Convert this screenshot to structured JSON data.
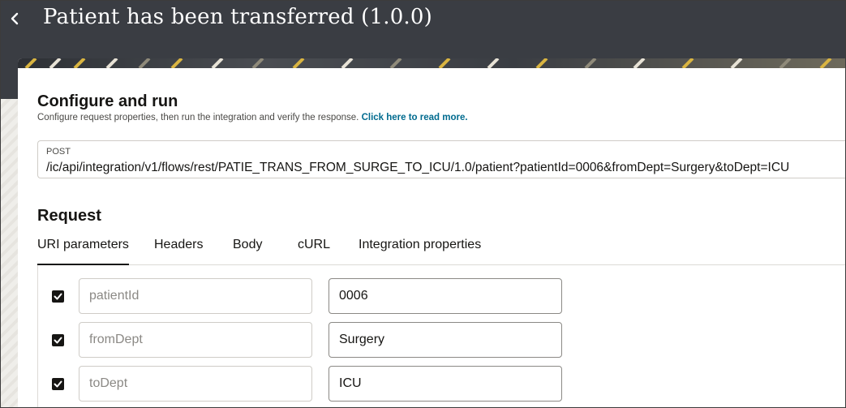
{
  "header": {
    "title": "Patient has been transferred (1.0.0)",
    "back_icon": "chevron-left-icon"
  },
  "configure": {
    "title": "Configure and run",
    "description": "Configure request properties, then run the integration and verify the response.",
    "link_text": "Click here to read more."
  },
  "endpoint": {
    "method": "POST",
    "url": "/ic/api/integration/v1/flows/rest/PATIE_TRANS_FROM_SURGE_TO_ICU/1.0/patient?patientId=0006&fromDept=Surgery&toDept=ICU"
  },
  "request": {
    "title": "Request",
    "tabs": [
      {
        "label": "URI parameters",
        "active": true
      },
      {
        "label": "Headers",
        "active": false
      },
      {
        "label": "Body",
        "active": false
      },
      {
        "label": "cURL",
        "active": false
      },
      {
        "label": "Integration properties",
        "active": false
      }
    ],
    "params": [
      {
        "name": "patientId",
        "value": "0006",
        "checked": true
      },
      {
        "name": "fromDept",
        "value": "Surgery",
        "checked": true
      },
      {
        "name": "toDept",
        "value": "ICU",
        "checked": true
      }
    ]
  },
  "colors": {
    "header_bg": "#3a3d43",
    "link": "#006b8f",
    "checkbox": "#161513"
  }
}
